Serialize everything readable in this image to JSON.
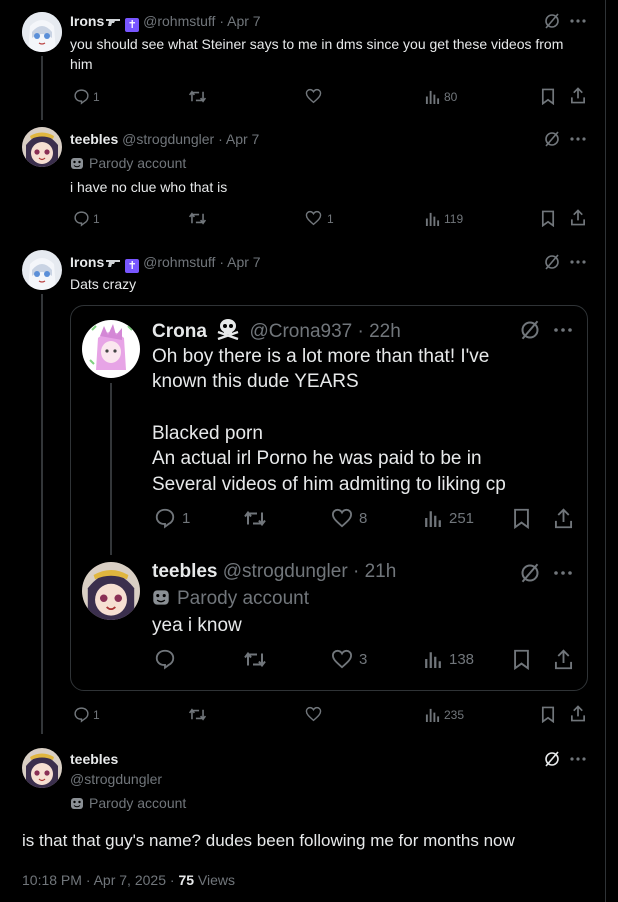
{
  "posts": [
    {
      "name": "Irons",
      "handle": "@rohmstuff",
      "date": "Apr 7",
      "text": "you should see what Steiner says to me in dms since you get these videos from him",
      "replies": "1",
      "likes": "",
      "views": "80",
      "name_emoji": "gun-icon",
      "badge_glyph": "✝"
    },
    {
      "name": "teebles",
      "handle": "@strogdungler",
      "date": "Apr 7",
      "parody_label": "Parody account",
      "text": "i have no clue who that is",
      "replies": "1",
      "likes": "1",
      "views": "119"
    },
    {
      "name": "Irons",
      "handle": "@rohmstuff",
      "date": "Apr 7",
      "text": "Dats crazy",
      "replies": "1",
      "likes": "",
      "views": "235"
    }
  ],
  "quote": {
    "first": {
      "name": "Crona",
      "name_emoji": "skull-crossbones-icon",
      "handle": "@Crona937",
      "date": "22h",
      "lines": [
        "Oh boy there is a lot more than that! I've",
        "known this dude YEARS",
        "",
        "Blacked porn",
        "An actual irl Porno he was paid to be in",
        "Several videos of him admiting to liking cp"
      ],
      "replies": "1",
      "likes": "8",
      "views": "251"
    },
    "second": {
      "name": "teebles",
      "handle": "@strogdungler",
      "date": "21h",
      "parody_label": "Parody account",
      "text": "yea i know",
      "likes": "3",
      "views": "138"
    }
  },
  "main": {
    "name": "teebles",
    "handle": "@strogdungler",
    "parody_label": "Parody account",
    "text": "is that that guy's name? dudes been following me for months now",
    "timestamp": "10:18 PM · Apr 7, 2025",
    "separator": " · ",
    "views_count": "75",
    "views_label": "Views"
  },
  "colors": {
    "background": "#000000",
    "text": "#e7e9ea",
    "muted": "#71767b",
    "border": "#2f3336",
    "badge": "#7856ff"
  }
}
